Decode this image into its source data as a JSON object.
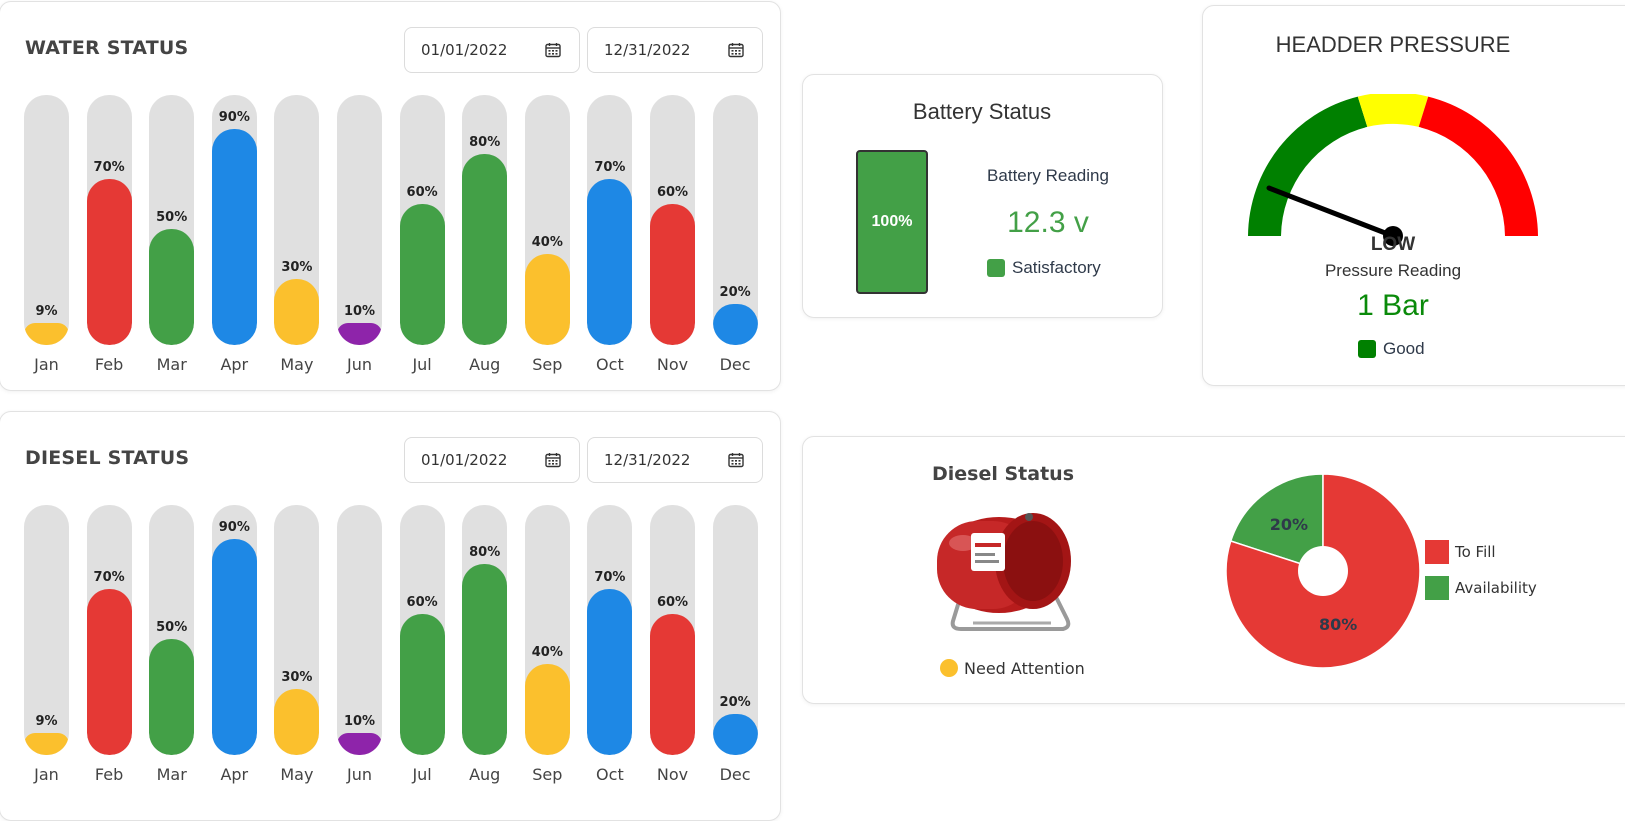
{
  "colors": {
    "red": "#e53935",
    "green": "#43a047",
    "blue": "#1e88e5",
    "yellow": "#fbc02d",
    "purple": "#8e24aa",
    "track": "#e0e0e0",
    "gauge_green": "#008000",
    "gauge_yellow": "#ffff00",
    "gauge_red": "#ff0000"
  },
  "water": {
    "title": "WATER STATUS",
    "start_date": "01/01/2022",
    "end_date": "12/31/2022",
    "calendar_icon": "calendar-icon"
  },
  "diesel_bars": {
    "title": "DIESEL STATUS",
    "start_date": "01/01/2022",
    "end_date": "12/31/2022",
    "calendar_icon": "calendar-icon"
  },
  "battery": {
    "title": "Battery Status",
    "level_label": "100%",
    "reading_label": "Battery Reading",
    "reading_value": "12.3 v",
    "status": "Satisfactory"
  },
  "pressure": {
    "title": "HEADDER PRESSURE",
    "needle_label": "LOW",
    "reading_label": "Pressure Reading",
    "reading_value": "1 Bar",
    "status": "Good"
  },
  "diesel_panel": {
    "title": "Diesel Status",
    "tank_icon": "diesel-tank-image",
    "status": "Need Attention"
  },
  "chart_data": [
    {
      "type": "bar",
      "title": "WATER STATUS",
      "categories": [
        "Jan",
        "Feb",
        "Mar",
        "Apr",
        "May",
        "Jun",
        "Jul",
        "Aug",
        "Sep",
        "Oct",
        "Nov",
        "Dec"
      ],
      "values": [
        9,
        70,
        50,
        90,
        30,
        10,
        60,
        80,
        40,
        70,
        60,
        20
      ],
      "labels": [
        "9%",
        "70%",
        "50%",
        "90%",
        "30%",
        "10%",
        "60%",
        "80%",
        "40%",
        "70%",
        "60%",
        "20%"
      ],
      "colors": [
        "yellow",
        "red",
        "green",
        "blue",
        "yellow",
        "purple",
        "green",
        "green",
        "yellow",
        "blue",
        "red",
        "blue"
      ],
      "ylim": [
        0,
        100
      ]
    },
    {
      "type": "bar",
      "title": "DIESEL STATUS",
      "categories": [
        "Jan",
        "Feb",
        "Mar",
        "Apr",
        "May",
        "Jun",
        "Jul",
        "Aug",
        "Sep",
        "Oct",
        "Nov",
        "Dec"
      ],
      "values": [
        9,
        70,
        50,
        90,
        30,
        10,
        60,
        80,
        40,
        70,
        60,
        20
      ],
      "labels": [
        "9%",
        "70%",
        "50%",
        "90%",
        "30%",
        "10%",
        "60%",
        "80%",
        "40%",
        "70%",
        "60%",
        "20%"
      ],
      "colors": [
        "yellow",
        "red",
        "green",
        "blue",
        "yellow",
        "purple",
        "green",
        "green",
        "yellow",
        "blue",
        "red",
        "blue"
      ],
      "ylim": [
        0,
        100
      ]
    },
    {
      "type": "pie",
      "series": [
        {
          "name": "To Fill",
          "value": 80,
          "label": "80%",
          "color": "#e53935"
        },
        {
          "name": "Availability",
          "value": 20,
          "label": "20%",
          "color": "#43a047"
        }
      ],
      "legend": "right"
    }
  ]
}
